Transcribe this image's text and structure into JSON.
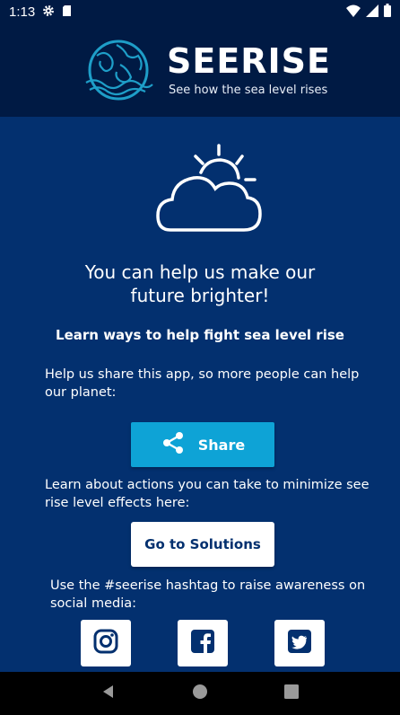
{
  "status_bar": {
    "time": "1:13",
    "icons": [
      "gear-icon",
      "sd-card-icon",
      "wifi-icon",
      "signal-icon",
      "battery-icon"
    ]
  },
  "header": {
    "app_name": "SEERISE",
    "tagline": "See how the sea level rises",
    "logo_icon": "globe-icon"
  },
  "main": {
    "hero_icon": "cloud-sun-icon",
    "headline_line1": "You can help us make our",
    "headline_line2": "future brighter!",
    "subheading": "Learn ways to help fight sea level rise",
    "share_text": "Help us share this app, so more people can help our planet:",
    "share_label": "Share",
    "solutions_text": "Learn about actions you can take to minimize see rise level effects here:",
    "solutions_label": "Go to Solutions",
    "hashtag_text": "Use the #seerise hashtag to raise awareness on social media:",
    "social": [
      "instagram-icon",
      "facebook-icon",
      "twitter-icon"
    ]
  },
  "colors": {
    "background": "#03306f",
    "header": "#001a44",
    "share_button": "#0ea3d6",
    "globe": "#1e9ec8"
  }
}
